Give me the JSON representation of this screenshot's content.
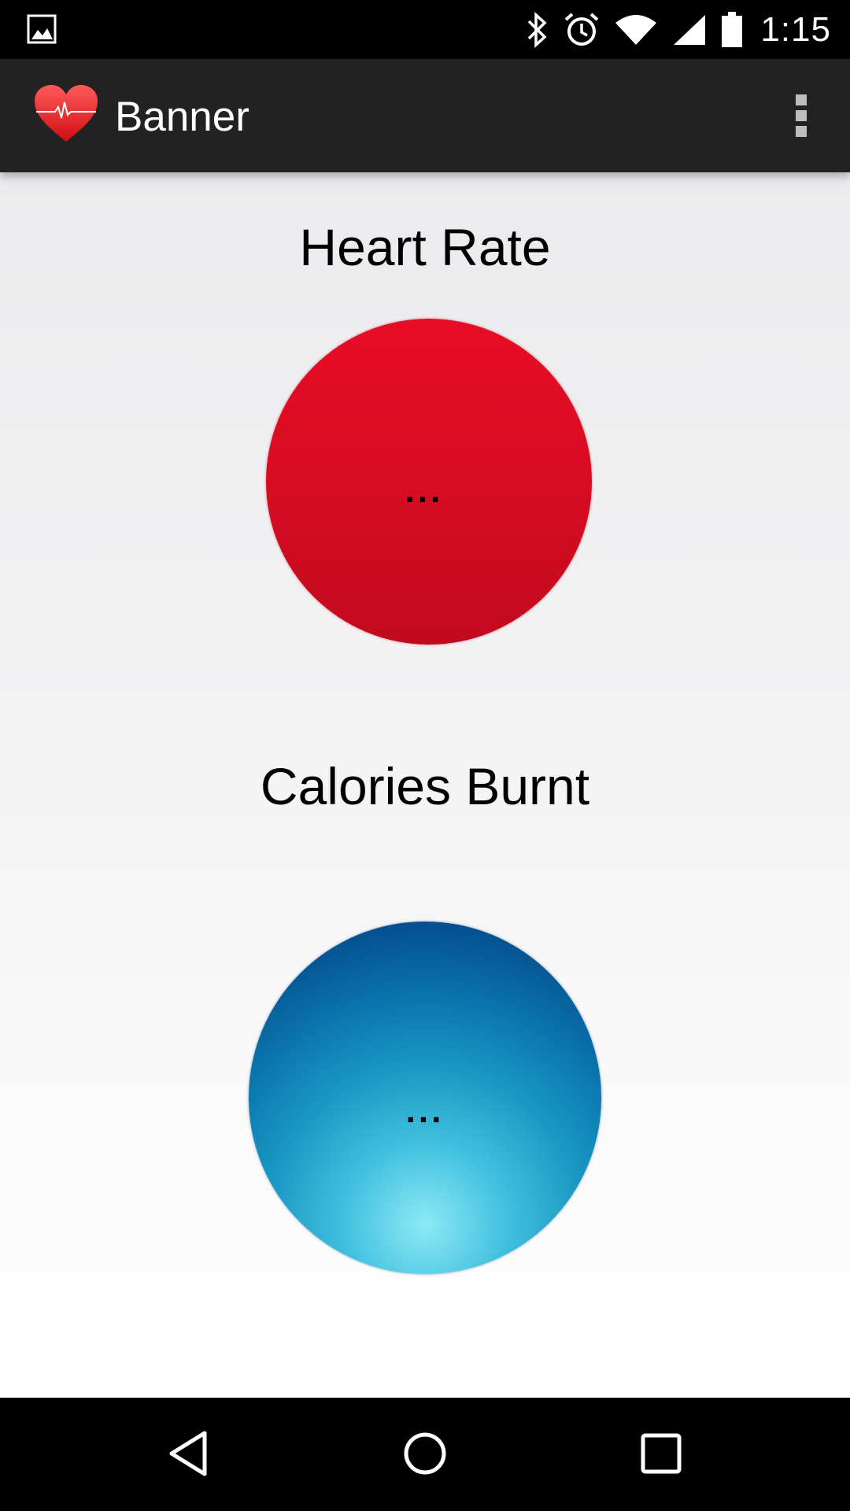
{
  "status_bar": {
    "time": "1:15",
    "icons": [
      "gallery-icon",
      "bluetooth-icon",
      "alarm-icon",
      "wifi-icon",
      "signal-icon",
      "battery-icon"
    ]
  },
  "action_bar": {
    "title": "Banner",
    "app_icon": "heart-pulse-icon",
    "overflow_icon": "overflow-menu-icon"
  },
  "main": {
    "heart_rate": {
      "title": "Heart Rate",
      "value": "...",
      "color": "#e00c24"
    },
    "calories": {
      "title": "Calories Burnt",
      "value": "...",
      "color": "#0a74ac"
    }
  },
  "nav_bar": {
    "icons": [
      "back-icon",
      "home-icon",
      "recents-icon"
    ]
  }
}
